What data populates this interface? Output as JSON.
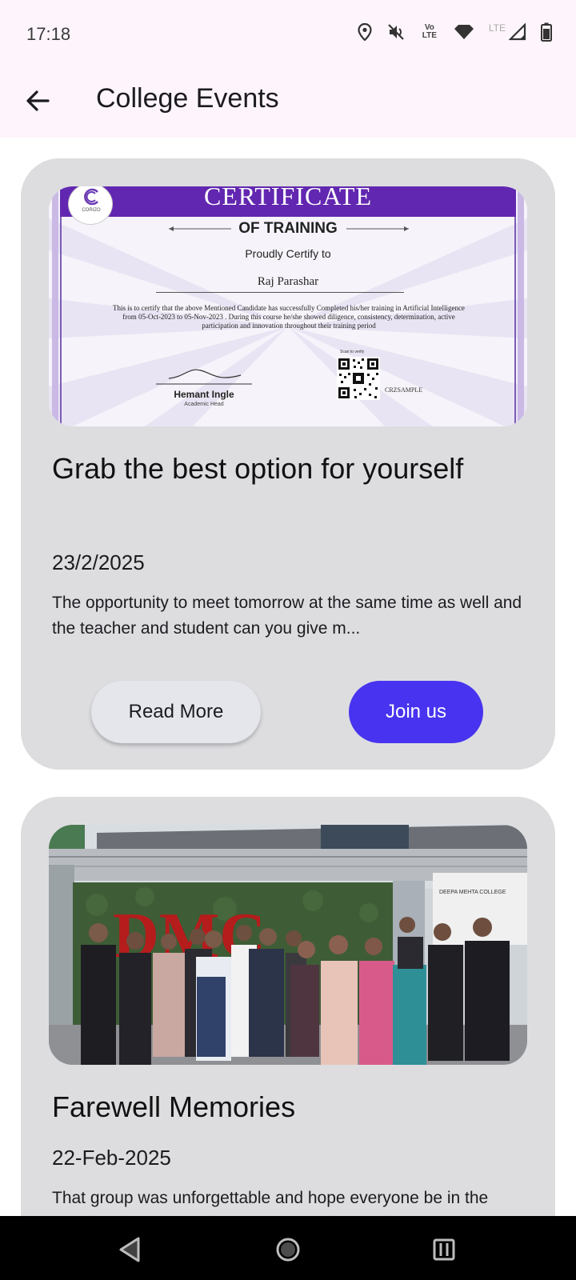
{
  "status_bar": {
    "time": "17:18",
    "volte_label": "Vo LTE",
    "lte_label": "LTE",
    "icons": [
      "location-icon",
      "mute-icon",
      "volte-icon",
      "wifi-icon",
      "signal-icon",
      "battery-icon"
    ]
  },
  "app_bar": {
    "title": "College Events",
    "back_icon": "arrow-back-icon"
  },
  "events": [
    {
      "image": {
        "heading": "CERTIFICATE",
        "subheading": "OF TRAINING",
        "logo_text": "CORIZO",
        "proudly": "Proudly Certify to",
        "recipient": "Raj Parashar",
        "body": "This is to certify that the above Mentioned Candidate has successfully Completed his/her training in Artificial Intelligence from 05-Oct-2023 to 05-Nov-2023 . During this course he/she showed diligence, consistency, determination, active participation and innovation throughout their training period",
        "signatory": "Hemant Ingle",
        "signatory_role": "Academic Head",
        "scan_label": "Scan to verify",
        "code": "CRZSAMPLE"
      },
      "title": "Grab the best option for yourself",
      "date": "23/2/2025",
      "description": "The opportunity to meet tomorrow at the same time as well and the teacher and student can you give m...",
      "read_more_label": "Read More",
      "join_label": "Join us"
    },
    {
      "image": {
        "sign_text": "DMC",
        "building_text": "DEEPA MEHTA COLLEGE"
      },
      "title": "Farewell Memories",
      "date": "22-Feb-2025",
      "description": "That group was unforgettable and hope everyone be in the"
    }
  ],
  "nav_bar": {
    "icons": [
      "back-nav-icon",
      "home-nav-icon",
      "recents-nav-icon"
    ]
  },
  "colors": {
    "app_bar_bg": "#fdf5fb",
    "card_bg": "#dddde0",
    "join_button": "#4833f0",
    "read_more_button": "#e4e6ec"
  }
}
